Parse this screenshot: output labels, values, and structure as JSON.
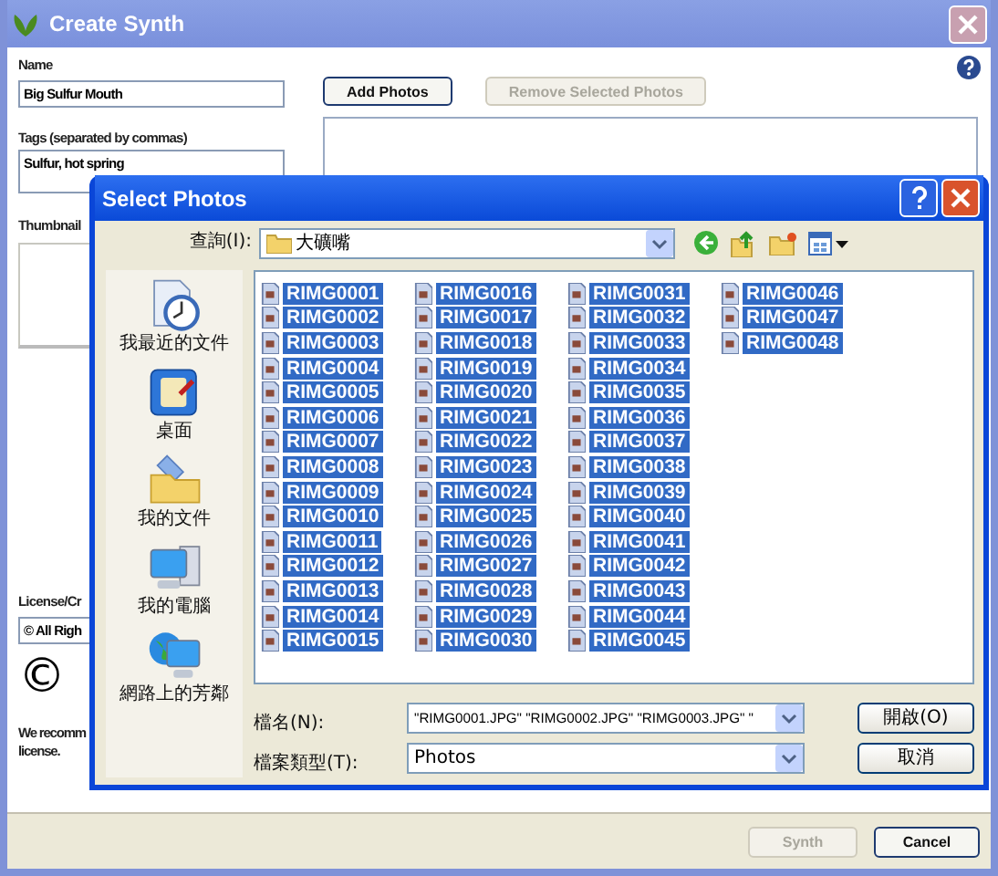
{
  "window": {
    "title": "Create Synth"
  },
  "form": {
    "name_label": "Name",
    "name_value": "Big Sulfur Mouth",
    "tags_label": "Tags (separated by commas)",
    "tags_value": "Sulfur, hot spring",
    "thumbnail_label": "Thumbnail",
    "license_label": "License/Cr",
    "license_value": "© All Righ",
    "license_symbol": "©",
    "note_lines": [
      "We recomm",
      "license."
    ]
  },
  "photos": {
    "buttons": [
      {
        "label": "Add Photos",
        "disabled": false
      },
      {
        "label": "Remove Selected Photos",
        "disabled": true
      }
    ]
  },
  "footer": {
    "buttons": [
      {
        "label": "Synth",
        "disabled": true
      },
      {
        "label": "Cancel",
        "disabled": false
      }
    ]
  },
  "dialog": {
    "title": "Select Photos",
    "look_in_label": "查詢(I):",
    "look_in_value": "大礦嘴",
    "places": [
      {
        "label": "我最近的文件",
        "kind": "recent"
      },
      {
        "label": "桌面",
        "kind": "desktop"
      },
      {
        "label": "我的文件",
        "kind": "documents"
      },
      {
        "label": "我的電腦",
        "kind": "computer"
      },
      {
        "label": "網路上的芳鄰",
        "kind": "network"
      }
    ],
    "files": [
      {
        "name": "RIMG0001",
        "selected": true
      },
      {
        "name": "RIMG0002",
        "selected": true
      },
      {
        "name": "RIMG0003",
        "selected": true
      },
      {
        "name": "RIMG0004",
        "selected": true
      },
      {
        "name": "RIMG0005",
        "selected": true
      },
      {
        "name": "RIMG0006",
        "selected": true
      },
      {
        "name": "RIMG0007",
        "selected": true
      },
      {
        "name": "RIMG0008",
        "selected": true
      },
      {
        "name": "RIMG0009",
        "selected": true
      },
      {
        "name": "RIMG0010",
        "selected": true
      },
      {
        "name": "RIMG0011",
        "selected": true
      },
      {
        "name": "RIMG0012",
        "selected": true
      },
      {
        "name": "RIMG0013",
        "selected": true
      },
      {
        "name": "RIMG0014",
        "selected": true
      },
      {
        "name": "RIMG0015",
        "selected": true
      },
      {
        "name": "RIMG0016",
        "selected": true
      },
      {
        "name": "RIMG0017",
        "selected": true
      },
      {
        "name": "RIMG0018",
        "selected": true
      },
      {
        "name": "RIMG0019",
        "selected": true
      },
      {
        "name": "RIMG0020",
        "selected": true
      },
      {
        "name": "RIMG0021",
        "selected": true
      },
      {
        "name": "RIMG0022",
        "selected": true
      },
      {
        "name": "RIMG0023",
        "selected": true
      },
      {
        "name": "RIMG0024",
        "selected": true
      },
      {
        "name": "RIMG0025",
        "selected": true
      },
      {
        "name": "RIMG0026",
        "selected": true
      },
      {
        "name": "RIMG0027",
        "selected": true
      },
      {
        "name": "RIMG0028",
        "selected": true
      },
      {
        "name": "RIMG0029",
        "selected": true
      },
      {
        "name": "RIMG0030",
        "selected": true
      },
      {
        "name": "RIMG0031",
        "selected": true
      },
      {
        "name": "RIMG0032",
        "selected": true
      },
      {
        "name": "RIMG0033",
        "selected": true
      },
      {
        "name": "RIMG0034",
        "selected": true
      },
      {
        "name": "RIMG0035",
        "selected": true
      },
      {
        "name": "RIMG0036",
        "selected": true
      },
      {
        "name": "RIMG0037",
        "selected": true
      },
      {
        "name": "RIMG0038",
        "selected": true
      },
      {
        "name": "RIMG0039",
        "selected": true
      },
      {
        "name": "RIMG0040",
        "selected": true
      },
      {
        "name": "RIMG0041",
        "selected": true
      },
      {
        "name": "RIMG0042",
        "selected": true
      },
      {
        "name": "RIMG0043",
        "selected": true
      },
      {
        "name": "RIMG0044",
        "selected": true
      },
      {
        "name": "RIMG0045",
        "selected": true
      },
      {
        "name": "RIMG0046",
        "selected": true
      },
      {
        "name": "RIMG0047",
        "selected": true
      },
      {
        "name": "RIMG0048",
        "selected": true
      }
    ],
    "file_name_label": "檔名(N):",
    "file_name_value": "\"RIMG0001.JPG\" \"RIMG0002.JPG\" \"RIMG0003.JPG\" \"",
    "file_type_label": "檔案類型(T):",
    "file_type_value": "Photos",
    "buttons": [
      "開啟(O)",
      "取消"
    ]
  }
}
